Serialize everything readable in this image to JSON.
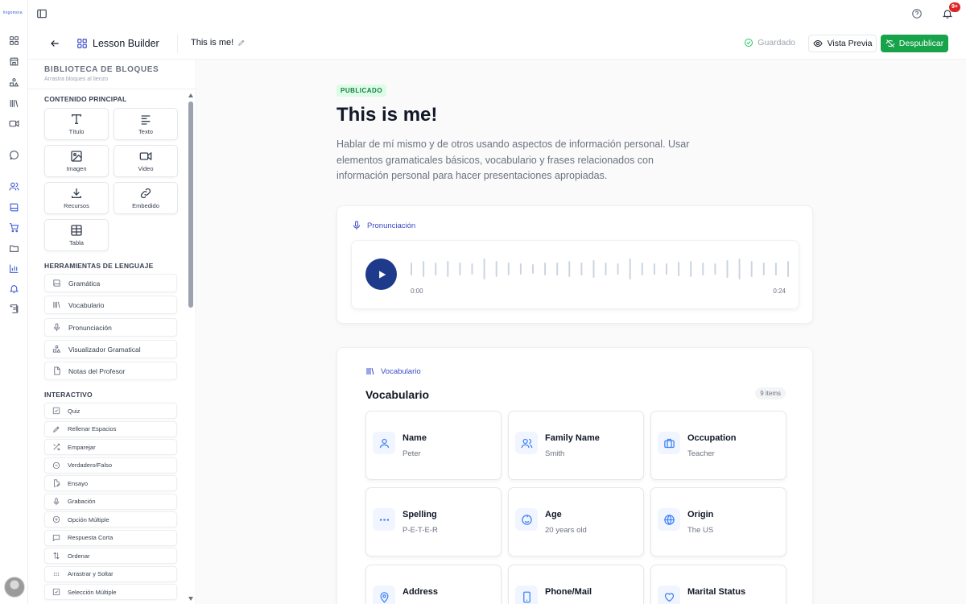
{
  "app": {
    "logo_text": "lingomora"
  },
  "topbar": {
    "notification_badge": "9+"
  },
  "header": {
    "section_label": "Lesson Builder",
    "doc_title": "This is me!",
    "save_status": "Guardado",
    "preview_label": "Vista Previa",
    "unpublish_label": "Despublicar"
  },
  "library": {
    "title": "BIBLIOTECA DE BLOQUES",
    "subtitle": "Arrastra bloques al lienzo",
    "main_section": "CONTENIDO PRINCIPAL",
    "main_blocks": [
      {
        "label": "Título",
        "icon": "text-type-icon"
      },
      {
        "label": "Texto",
        "icon": "align-left-icon"
      },
      {
        "label": "Imagen",
        "icon": "image-icon"
      },
      {
        "label": "Video",
        "icon": "video-icon"
      },
      {
        "label": "Recursos",
        "icon": "download-icon"
      },
      {
        "label": "Embedido",
        "icon": "link-icon"
      },
      {
        "label": "Tabla",
        "icon": "table-icon"
      }
    ],
    "language_section": "HERRAMIENTAS DE LENGUAJE",
    "language_tools": [
      {
        "label": "Gramática",
        "icon": "book-icon"
      },
      {
        "label": "Vocabulario",
        "icon": "library-icon"
      },
      {
        "label": "Pronunciación",
        "icon": "mic-icon"
      },
      {
        "label": "Visualizador Gramatical",
        "icon": "shapes-icon"
      },
      {
        "label": "Notas del Profesor",
        "icon": "file-icon"
      }
    ],
    "interactive_section": "INTERACTIVO",
    "interactive": [
      {
        "label": "Quiz",
        "icon": "check-square-icon"
      },
      {
        "label": "Rellenar Espacios",
        "icon": "pencil-icon"
      },
      {
        "label": "Emparejar",
        "icon": "shuffle-icon"
      },
      {
        "label": "Verdadero/Falso",
        "icon": "circle-minus-icon"
      },
      {
        "label": "Ensayo",
        "icon": "file-edit-icon"
      },
      {
        "label": "Grabación",
        "icon": "mic-icon"
      },
      {
        "label": "Opción Múltiple",
        "icon": "circle-plus-icon"
      },
      {
        "label": "Respuesta Corta",
        "icon": "message-square-icon"
      },
      {
        "label": "Ordenar",
        "icon": "arrow-up-down-icon"
      },
      {
        "label": "Arrastrar y Soltar",
        "icon": "grip-icon"
      },
      {
        "label": "Selección Múltiple",
        "icon": "check-square-icon"
      }
    ]
  },
  "lesson": {
    "status": "PUBLICADO",
    "title": "This is me!",
    "description": "Hablar de mí mismo y de otros usando aspectos de información personal. Usar elementos gramaticales básicos, vocabulario y frases relacionados con información personal para hacer presentaciones apropiadas."
  },
  "pronunciation": {
    "label": "Pronunciación",
    "time_start": "0:00",
    "time_end": "0:24"
  },
  "vocabulary": {
    "label": "Vocabulario",
    "title": "Vocabulario",
    "count": "9 items",
    "items": [
      {
        "label": "Name",
        "value": "Peter",
        "icon": "user-icon"
      },
      {
        "label": "Family Name",
        "value": "Smith",
        "icon": "users-icon"
      },
      {
        "label": "Occupation",
        "value": "Teacher",
        "icon": "briefcase-icon"
      },
      {
        "label": "Spelling",
        "value": "P-E-T-E-R",
        "icon": "ellipsis-icon"
      },
      {
        "label": "Age",
        "value": "20 years old",
        "icon": "cake-icon"
      },
      {
        "label": "Origin",
        "value": "The US",
        "icon": "globe-icon"
      },
      {
        "label": "Address",
        "value": "",
        "icon": "map-pin-icon"
      },
      {
        "label": "Phone/Mail",
        "value": "",
        "icon": "phone-icon"
      },
      {
        "label": "Marital Status",
        "value": "",
        "icon": "heart-icon"
      }
    ]
  },
  "colors": {
    "accent": "#3b4bc8",
    "primary_button": "#16a34a",
    "play_button": "#1e3a8a",
    "badge": "#dc2626"
  }
}
